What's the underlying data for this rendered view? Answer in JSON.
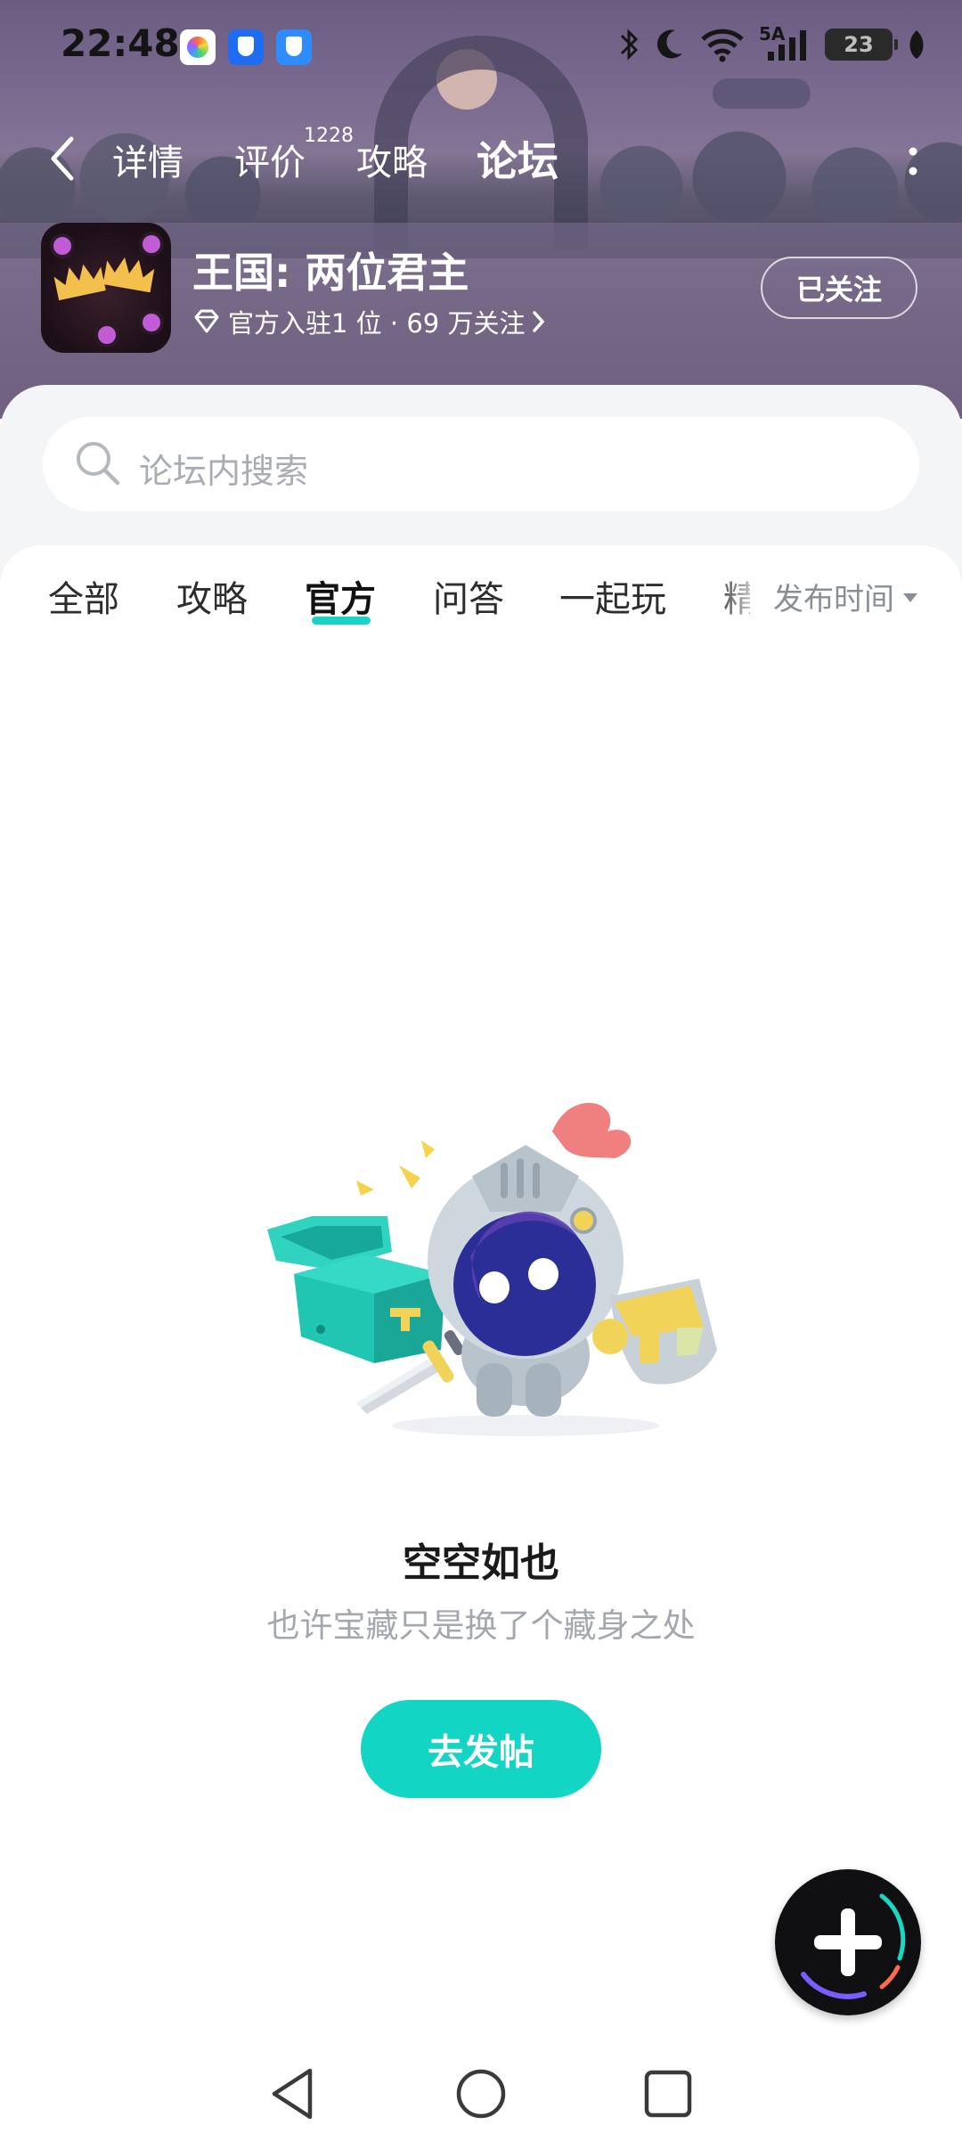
{
  "status_bar": {
    "time": "22:48",
    "network": "5A",
    "battery": "23"
  },
  "nav": {
    "tabs": [
      "详情",
      "评价",
      "攻略",
      "论坛"
    ],
    "review_count": "1228",
    "active_tab": "论坛"
  },
  "game": {
    "title": "王国: 两位君主",
    "meta": "官方入驻1 位 · 69 万关注",
    "follow_label": "已关注"
  },
  "search": {
    "placeholder": "论坛内搜索"
  },
  "filters": {
    "tabs": [
      "全部",
      "攻略",
      "官方",
      "问答",
      "一起玩",
      "精"
    ],
    "active": "官方",
    "sort_label": "发布时间"
  },
  "empty_state": {
    "title": "空空如也",
    "subtitle": "也许宝藏只是换了个藏身之处",
    "button_label": "去发帖"
  },
  "colors": {
    "accent": "#12d6c3",
    "underline": "#19d3c5"
  },
  "icons": [
    "back-icon",
    "more-icon",
    "diamond-icon",
    "chevron-right-icon",
    "search-icon",
    "plus-icon",
    "nav-back-icon",
    "nav-home-icon",
    "nav-recent-icon"
  ]
}
